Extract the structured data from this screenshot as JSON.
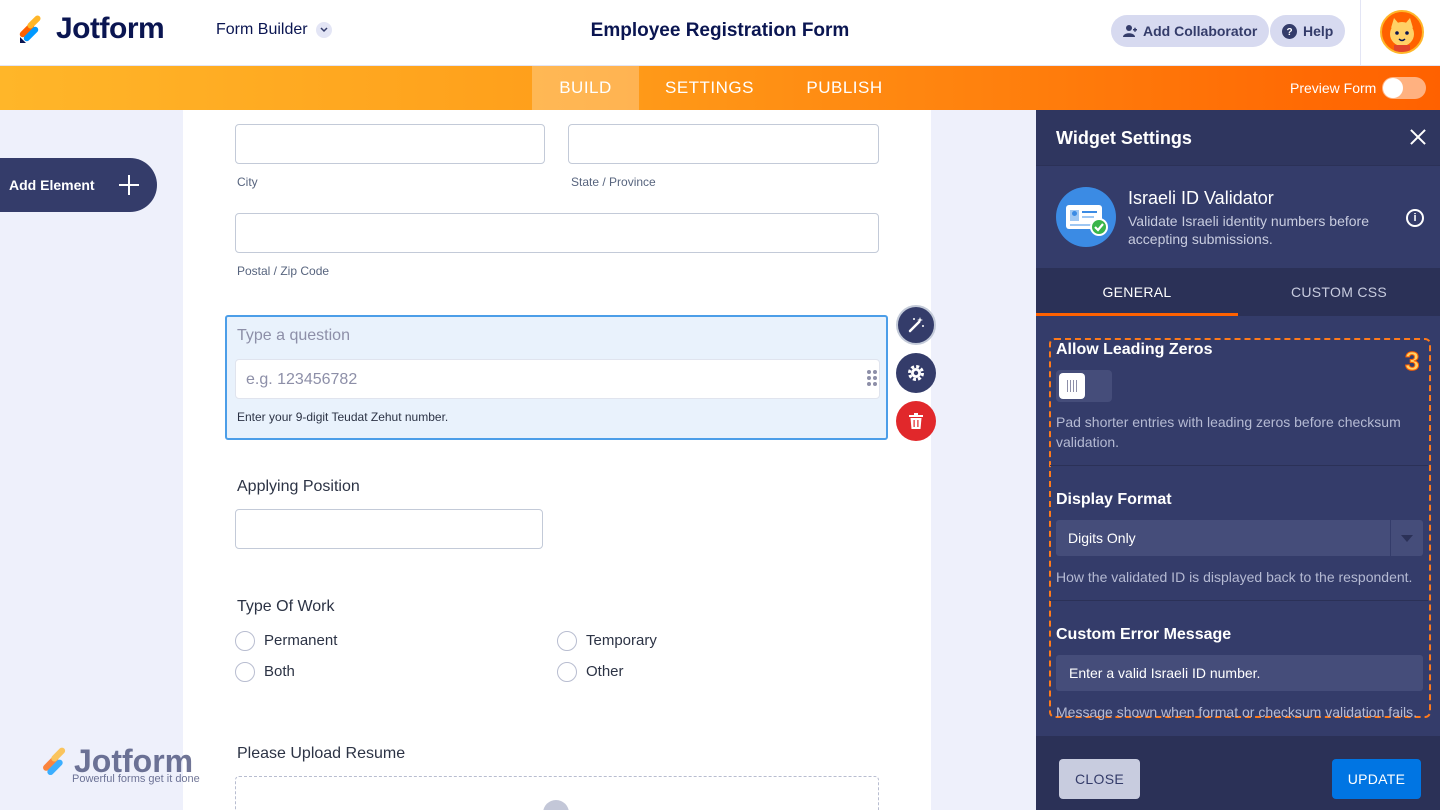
{
  "header": {
    "logo_text": "Jotform",
    "builder_label": "Form Builder",
    "form_title": "Employee Registration Form",
    "add_collaborator": "Add Collaborator",
    "help": "Help"
  },
  "nav": {
    "tabs": [
      "BUILD",
      "SETTINGS",
      "PUBLISH"
    ],
    "active_tab": "BUILD",
    "preview_label": "Preview Form",
    "preview_on": false
  },
  "sidebar": {
    "add_element": "Add Element"
  },
  "form": {
    "city_label": "City",
    "state_label": "State / Province",
    "zip_label": "Postal / Zip Code",
    "selected_question": {
      "label": "Type a question",
      "placeholder": "e.g. 123456782",
      "help": "Enter your 9-digit Teudat Zehut number."
    },
    "applying_position": "Applying Position",
    "type_of_work": {
      "label": "Type Of Work",
      "options": [
        "Permanent",
        "Temporary",
        "Both",
        "Other"
      ]
    },
    "upload_label": "Please Upload Resume"
  },
  "watermark": {
    "word": "Jotform",
    "tagline": "Powerful forms get it done"
  },
  "panel": {
    "title": "Widget Settings",
    "widget_name": "Israeli ID Validator",
    "widget_desc": "Validate Israeli identity numbers before accepting submissions.",
    "tabs": [
      "GENERAL",
      "CUSTOM CSS"
    ],
    "step_badge": "3",
    "settings": {
      "leading_zeros": {
        "title": "Allow Leading Zeros",
        "enabled": false,
        "desc": "Pad shorter entries with leading zeros before checksum validation."
      },
      "display_format": {
        "title": "Display Format",
        "value": "Digits Only",
        "desc": "How the validated ID is displayed back to the respondent."
      },
      "error_message": {
        "title": "Custom Error Message",
        "value": "Enter a valid Israeli ID number.",
        "desc": "Message shown when format or checksum validation fails."
      }
    },
    "close_label": "CLOSE",
    "update_label": "UPDATE"
  },
  "colors": {
    "brand_orange": "#ff6100",
    "brand_navy": "#0a1551",
    "panel_bg": "#343c6a",
    "primary_blue": "#0075e3",
    "selected_border": "#4c9ee8"
  }
}
